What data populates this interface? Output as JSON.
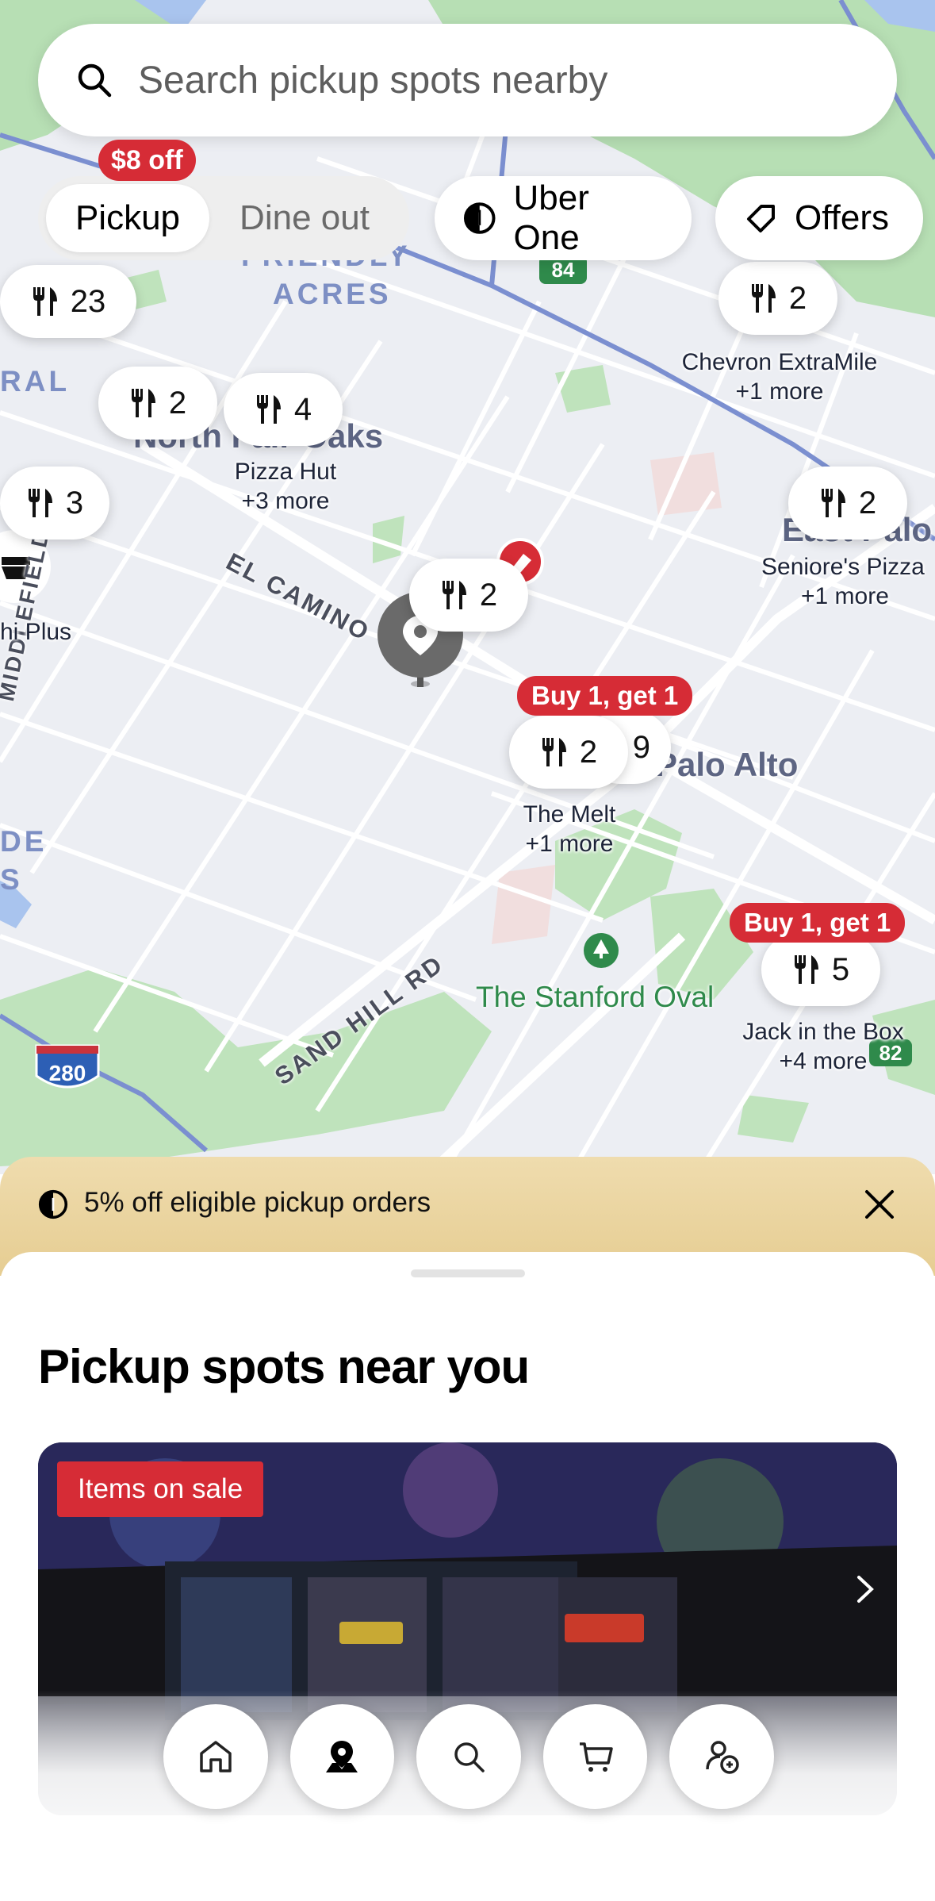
{
  "search": {
    "placeholder": "Search pickup spots nearby"
  },
  "mode_toggle": {
    "active": "Pickup",
    "inactive": "Dine out",
    "discount_badge": "$8 off"
  },
  "chips": [
    {
      "label": "Uber One",
      "icon": "uber-one-icon"
    },
    {
      "label": "Offers",
      "icon": "tag-icon"
    }
  ],
  "map": {
    "area_labels": [
      "FRIENDLY",
      "ACRES",
      "RAL",
      "DE",
      "S"
    ],
    "road_labels": [
      "EL CAMINO",
      "SAND HILL RD",
      "MIDDLEFIELD"
    ],
    "city_labels": [
      "North Fair Oaks",
      "Palo Alto",
      "East Palo"
    ],
    "park_label": "The Stanford Oval",
    "highway_shields": [
      "84",
      "280",
      "82"
    ],
    "clusters": [
      {
        "count": "23"
      },
      {
        "count": "2",
        "place": "Chevron ExtraMile",
        "more": "+1 more"
      },
      {
        "count": "2"
      },
      {
        "count": "4",
        "place": "Pizza Hut",
        "more": "+3 more"
      },
      {
        "count": "3"
      },
      {
        "count": "2",
        "place": "Seniore's Pizza",
        "more": "+1 more"
      },
      {
        "count": "2"
      },
      {
        "count": "2",
        "place": "The Melt",
        "more": "+1 more",
        "promo": "Buy 1, get 1"
      },
      {
        "count": "9"
      },
      {
        "count": "5",
        "place": "Jack in the Box",
        "more": "+4 more",
        "promo": "Buy 1, get 1"
      }
    ],
    "partial_place": "hi Plus"
  },
  "banner": {
    "text": "5% off eligible pickup orders",
    "icon": "uber-one-icon"
  },
  "sheet": {
    "title": "Pickup spots near you",
    "card": {
      "tag": "Items on sale"
    }
  },
  "nav": [
    "home-icon",
    "map-pin-icon",
    "search-icon",
    "cart-icon",
    "account-icon"
  ],
  "colors": {
    "promo_red": "#d62c36",
    "park_green": "#b8dfb5",
    "highway_blue": "#7b8fd0",
    "banner_gold": "#ebd59f"
  }
}
